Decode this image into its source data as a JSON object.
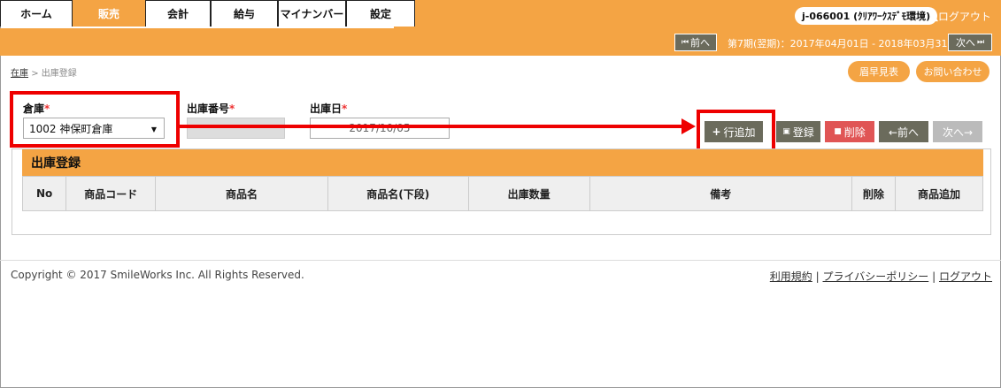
{
  "nav": {
    "tabs": [
      {
        "label": "ホーム",
        "active": false
      },
      {
        "label": "販売",
        "active": true
      },
      {
        "label": "会計",
        "active": false
      },
      {
        "label": "給与",
        "active": false
      },
      {
        "label": "マイナンバー",
        "active": false
      },
      {
        "label": "設定",
        "active": false
      }
    ],
    "user": "j-066001 (ｸﾘｱﾜｰｸｽﾃﾞﾓ環境)",
    "logout": "ログアウト"
  },
  "period": {
    "prev_label": "前へ",
    "text": "第7期(翌期)：2017年04月01日 - 2018年03月31日",
    "next_label": "次へ"
  },
  "breadcrumb": {
    "parent": "在庫",
    "separator": ">",
    "current": "出庫登録"
  },
  "header_buttons": {
    "quote": "眉早見表",
    "contact": "お問い合わせ"
  },
  "form": {
    "warehouse_label": "倉庫",
    "warehouse_value": "1002 神保町倉庫",
    "number_label": "出庫番号",
    "date_label": "出庫日",
    "date_value": "2017/10/05",
    "required_mark": "*"
  },
  "actions": {
    "add_row": "行追加",
    "register": "登録",
    "delete": "削除",
    "prev": "←前へ",
    "next": "次へ→"
  },
  "table": {
    "title": "出庫登録",
    "columns": [
      "No",
      "商品コード",
      "商品名",
      "商品名(下段)",
      "出庫数量",
      "備考",
      "削除",
      "商品追加"
    ]
  },
  "footer": {
    "copyright": "Copyright © 2017 SmileWorks Inc. All Rights Reserved.",
    "terms": "利用規約",
    "privacy": "プライバシーポリシー",
    "logout": "ログアウト",
    "sep": "|"
  },
  "colors": {
    "accent": "#f4a444",
    "highlight": "#e00000",
    "dark_button": "#6b6b5c",
    "delete_button": "#e05555"
  }
}
